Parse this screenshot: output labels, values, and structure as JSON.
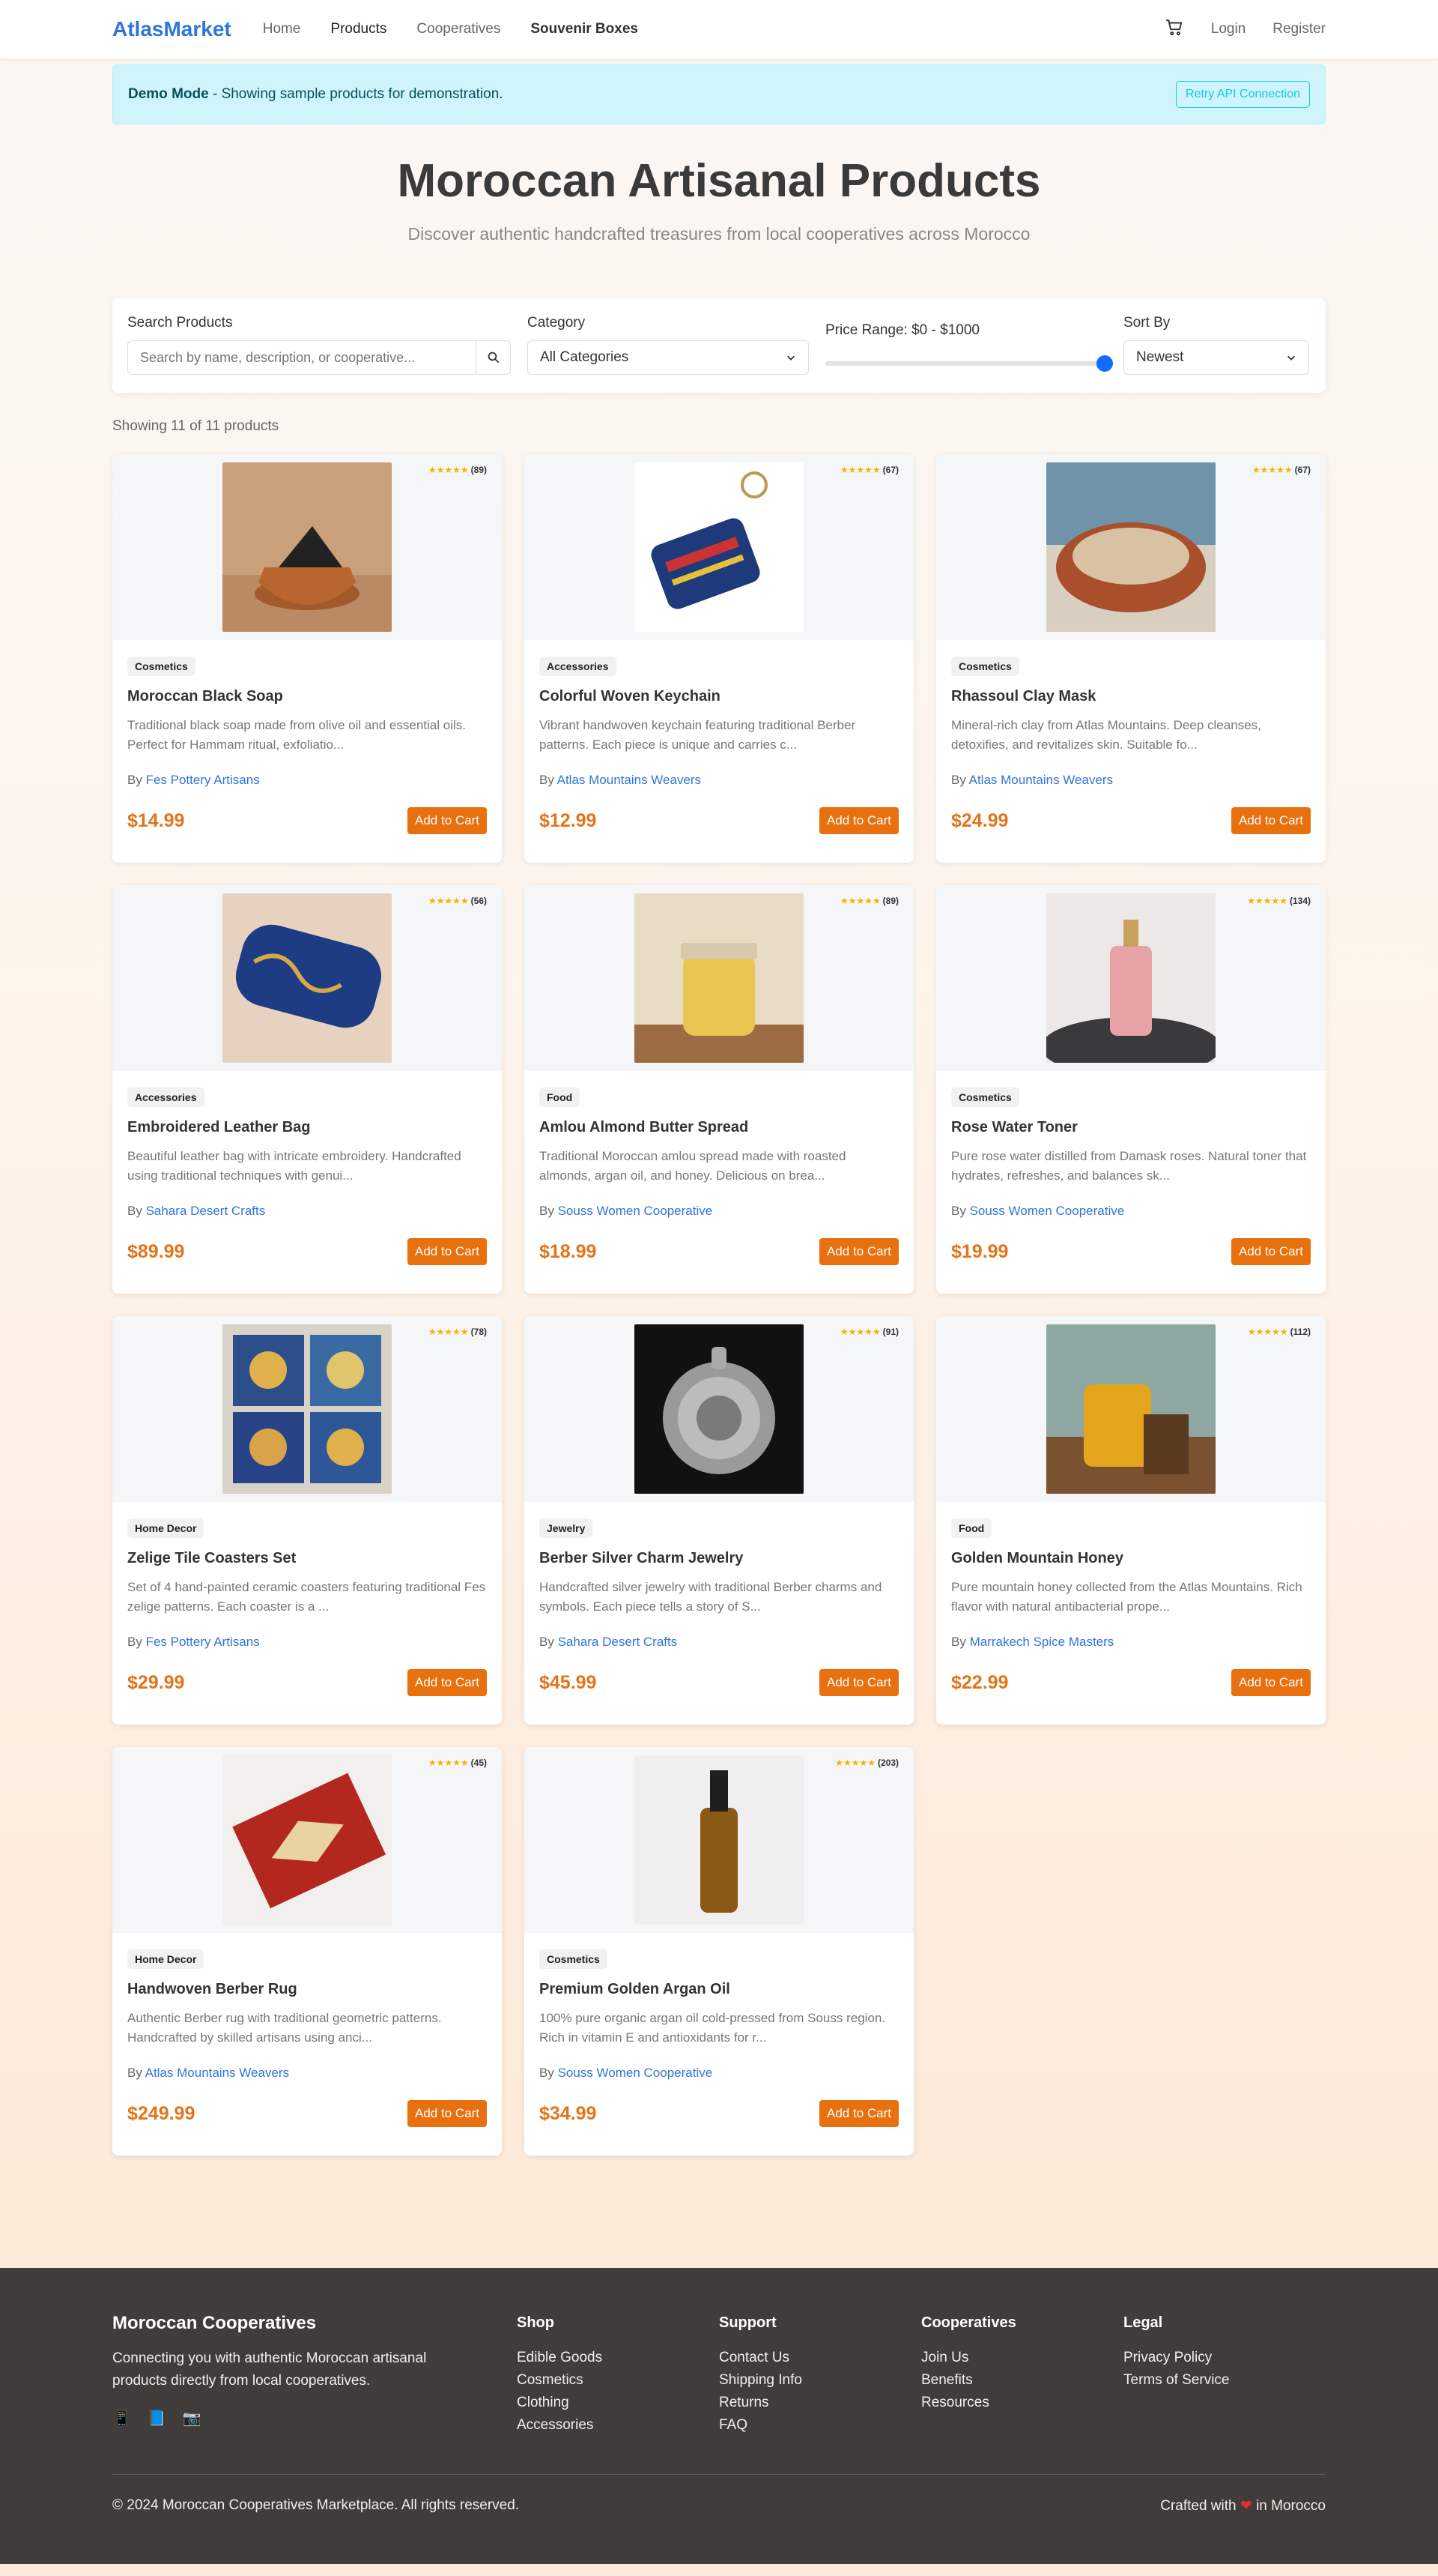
{
  "nav": {
    "brand": "AtlasMarket",
    "links": [
      "Home",
      "Products",
      "Cooperatives",
      "Souvenir Boxes"
    ],
    "login": "Login",
    "register": "Register"
  },
  "alert": {
    "title": "Demo Mode",
    "message": " - Showing sample products for demonstration.",
    "retry": "Retry API Connection"
  },
  "hero": {
    "title": "Moroccan Artisanal Products",
    "subtitle": "Discover authentic handcrafted treasures from local cooperatives across Morocco"
  },
  "filters": {
    "search_label": "Search Products",
    "search_placeholder": "Search by name, description, or cooperative...",
    "category_label": "Category",
    "category_value": "All Categories",
    "price_label": "Price Range: $0 - $1000",
    "price_value": 1000,
    "sort_label": "Sort By",
    "sort_value": "Newest"
  },
  "count": "Showing 11 of 11 products",
  "products": [
    {
      "category": "Cosmetics",
      "name": "Moroccan Black Soap",
      "desc": "Traditional black soap made from olive oil and essential oils. Perfect for Hammam ritual, exfoliatio...",
      "by": "By ",
      "coop": "Fes Pottery Artisans",
      "price": "$14.99",
      "stars": "★★★★★",
      "reviews": "(89)",
      "cart": "Add to Cart"
    },
    {
      "category": "Accessories",
      "name": "Colorful Woven Keychain",
      "desc": "Vibrant handwoven keychain featuring traditional Berber patterns. Each piece is unique and carries c...",
      "by": "By ",
      "coop": "Atlas Mountains Weavers",
      "price": "$12.99",
      "stars": "★★★★★",
      "reviews": "(67)",
      "cart": "Add to Cart"
    },
    {
      "category": "Cosmetics",
      "name": "Rhassoul Clay Mask",
      "desc": "Mineral-rich clay from Atlas Mountains. Deep cleanses, detoxifies, and revitalizes skin. Suitable fo...",
      "by": "By ",
      "coop": "Atlas Mountains Weavers",
      "price": "$24.99",
      "stars": "★★★★★",
      "reviews": "(67)",
      "cart": "Add to Cart"
    },
    {
      "category": "Accessories",
      "name": "Embroidered Leather Bag",
      "desc": "Beautiful leather bag with intricate embroidery. Handcrafted using traditional techniques with genui...",
      "by": "By ",
      "coop": "Sahara Desert Crafts",
      "price": "$89.99",
      "stars": "★★★★★",
      "reviews": "(56)",
      "cart": "Add to Cart"
    },
    {
      "category": "Food",
      "name": "Amlou Almond Butter Spread",
      "desc": "Traditional Moroccan amlou spread made with roasted almonds, argan oil, and honey. Delicious on brea...",
      "by": "By ",
      "coop": "Souss Women Cooperative",
      "price": "$18.99",
      "stars": "★★★★★",
      "reviews": "(89)",
      "cart": "Add to Cart"
    },
    {
      "category": "Cosmetics",
      "name": "Rose Water Toner",
      "desc": "Pure rose water distilled from Damask roses. Natural toner that hydrates, refreshes, and balances sk...",
      "by": "By ",
      "coop": "Souss Women Cooperative",
      "price": "$19.99",
      "stars": "★★★★★",
      "reviews": "(134)",
      "cart": "Add to Cart"
    },
    {
      "category": "Home Decor",
      "name": "Zelige Tile Coasters Set",
      "desc": "Set of 4 hand-painted ceramic coasters featuring traditional Fes zelige patterns. Each coaster is a ...",
      "by": "By ",
      "coop": "Fes Pottery Artisans",
      "price": "$29.99",
      "stars": "★★★★★",
      "reviews": "(78)",
      "cart": "Add to Cart"
    },
    {
      "category": "Jewelry",
      "name": "Berber Silver Charm Jewelry",
      "desc": "Handcrafted silver jewelry with traditional Berber charms and symbols. Each piece tells a story of S...",
      "by": "By ",
      "coop": "Sahara Desert Crafts",
      "price": "$45.99",
      "stars": "★★★★★",
      "reviews": "(91)",
      "cart": "Add to Cart"
    },
    {
      "category": "Food",
      "name": "Golden Mountain Honey",
      "desc": "Pure mountain honey collected from the Atlas Mountains. Rich flavor with natural antibacterial prope...",
      "by": "By ",
      "coop": "Marrakech Spice Masters",
      "price": "$22.99",
      "stars": "★★★★★",
      "reviews": "(112)",
      "cart": "Add to Cart"
    },
    {
      "category": "Home Decor",
      "name": "Handwoven Berber Rug",
      "desc": "Authentic Berber rug with traditional geometric patterns. Handcrafted by skilled artisans using anci...",
      "by": "By ",
      "coop": "Atlas Mountains Weavers",
      "price": "$249.99",
      "stars": "★★★★★",
      "reviews": "(45)",
      "cart": "Add to Cart"
    },
    {
      "category": "Cosmetics",
      "name": "Premium Golden Argan Oil",
      "desc": "100% pure organic argan oil cold-pressed from Souss region. Rich in vitamin E and antioxidants for r...",
      "by": "By ",
      "coop": "Souss Women Cooperative",
      "price": "$34.99",
      "stars": "★★★★★",
      "reviews": "(203)",
      "cart": "Add to Cart"
    }
  ],
  "footer": {
    "title": "Moroccan Cooperatives",
    "about": "Connecting you with authentic Moroccan artisanal products directly from local cooperatives.",
    "shop_title": "Shop",
    "shop": [
      "Edible Goods",
      "Cosmetics",
      "Clothing",
      "Accessories"
    ],
    "support_title": "Support",
    "support": [
      "Contact Us",
      "Shipping Info",
      "Returns",
      "FAQ"
    ],
    "coops_title": "Cooperatives",
    "coops": [
      "Join Us",
      "Benefits",
      "Resources"
    ],
    "legal_title": "Legal",
    "legal": [
      "Privacy Policy",
      "Terms of Service"
    ],
    "copyright": "© 2024 Moroccan Cooperatives Marketplace. All rights reserved.",
    "crafted_a": "Crafted with",
    "crafted_b": "in Morocco"
  },
  "colors": {
    "brand": "#2f76d8",
    "accent": "#e8700f",
    "alert_bg": "#cff4fc",
    "footer_bg": "#403c39"
  }
}
